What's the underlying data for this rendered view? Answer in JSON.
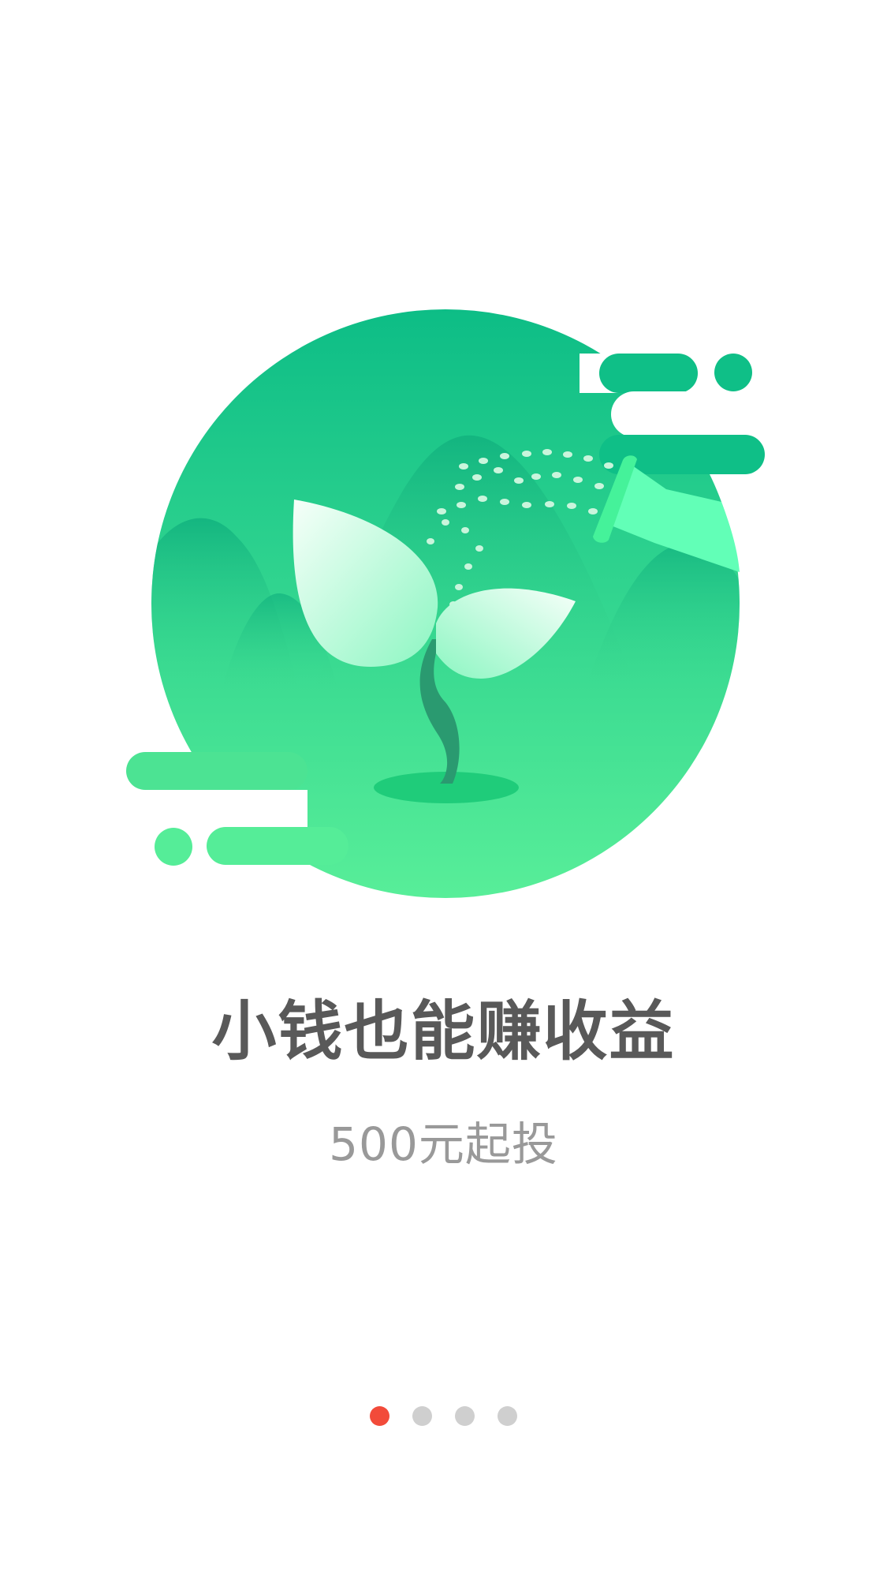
{
  "slide": {
    "title": "小钱也能赚收益",
    "subtitle": "500元起投"
  },
  "illustration": {
    "subject": "seedling-watering-illustration"
  },
  "pager": {
    "total": 4,
    "active_index": 0
  },
  "colors": {
    "accent_green_top": "#0fbf87",
    "accent_green_bottom": "#57ee98",
    "pager_active": "#f24b3a",
    "pager_inactive": "#cfcfcf",
    "title_text": "#595959",
    "subtitle_text": "#999999"
  }
}
